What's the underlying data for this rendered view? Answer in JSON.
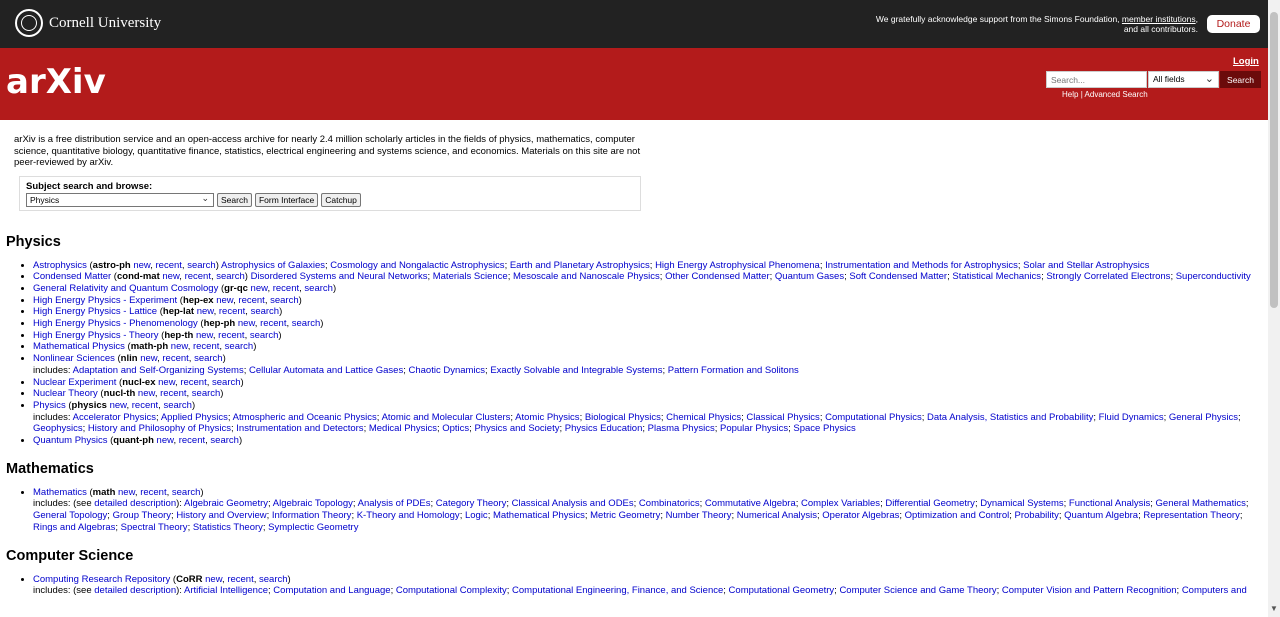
{
  "topbar": {
    "university": "Cornell University",
    "ack_prefix": "We gratefully acknowledge support from the Simons Foundation,",
    "ack_link": "member institutions",
    "ack_suffix": ", and all contributors.",
    "donate": "Donate"
  },
  "header": {
    "logo": "arXiv",
    "login": "Login",
    "search_placeholder": "Search...",
    "field_select": "All fields",
    "search_button": "Search",
    "help": "Help",
    "separator": "|",
    "advanced_search": "Advanced Search"
  },
  "intro": "arXiv is a free distribution service and an open-access archive for nearly 2.4 million scholarly articles in the fields of physics, mathematics, computer science, quantitative biology, quantitative finance, statistics, electrical engineering and systems science, and economics. Materials on this site are not peer-reviewed by arXiv.",
  "subject": {
    "label": "Subject search and browse:",
    "selected": "Physics",
    "search": "Search",
    "form_interface": "Form Interface",
    "catchup": "Catchup"
  },
  "headings": {
    "physics": "Physics",
    "mathematics": "Mathematics",
    "cs": "Computer Science"
  },
  "common": {
    "new": "new",
    "recent": "recent",
    "search": "search",
    "includes": "includes:",
    "see": "(see",
    "detailed_description": "detailed description"
  },
  "physics": {
    "astro": {
      "name": "Astrophysics",
      "code": "astro-ph",
      "subs": [
        "Astrophysics of Galaxies",
        "Cosmology and Nongalactic Astrophysics",
        "Earth and Planetary Astrophysics",
        "High Energy Astrophysical Phenomena",
        "Instrumentation and Methods for Astrophysics",
        "Solar and Stellar Astrophysics"
      ]
    },
    "cond": {
      "name": "Condensed Matter",
      "code": "cond-mat",
      "subs": [
        "Disordered Systems and Neural Networks",
        "Materials Science",
        "Mesoscale and Nanoscale Physics",
        "Other Condensed Matter",
        "Quantum Gases",
        "Soft Condensed Matter",
        "Statistical Mechanics",
        "Strongly Correlated Electrons",
        "Superconductivity"
      ]
    },
    "grqc": {
      "name": "General Relativity and Quantum Cosmology",
      "code": "gr-qc"
    },
    "hepex": {
      "name": "High Energy Physics - Experiment",
      "code": "hep-ex"
    },
    "heplat": {
      "name": "High Energy Physics - Lattice",
      "code": "hep-lat"
    },
    "hepph": {
      "name": "High Energy Physics - Phenomenology",
      "code": "hep-ph"
    },
    "hepth": {
      "name": "High Energy Physics - Theory",
      "code": "hep-th"
    },
    "mathph": {
      "name": "Mathematical Physics",
      "code": "math-ph"
    },
    "nlin": {
      "name": "Nonlinear Sciences",
      "code": "nlin",
      "subs": [
        "Adaptation and Self-Organizing Systems",
        "Cellular Automata and Lattice Gases",
        "Chaotic Dynamics",
        "Exactly Solvable and Integrable Systems",
        "Pattern Formation and Solitons"
      ]
    },
    "nuclex": {
      "name": "Nuclear Experiment",
      "code": "nucl-ex"
    },
    "nuclth": {
      "name": "Nuclear Theory",
      "code": "nucl-th"
    },
    "physics": {
      "name": "Physics",
      "code": "physics",
      "subs": [
        "Accelerator Physics",
        "Applied Physics",
        "Atmospheric and Oceanic Physics",
        "Atomic and Molecular Clusters",
        "Atomic Physics",
        "Biological Physics",
        "Chemical Physics",
        "Classical Physics",
        "Computational Physics",
        "Data Analysis, Statistics and Probability",
        "Fluid Dynamics",
        "General Physics",
        "Geophysics",
        "History and Philosophy of Physics",
        "Instrumentation and Detectors",
        "Medical Physics",
        "Optics",
        "Physics and Society",
        "Physics Education",
        "Plasma Physics",
        "Popular Physics",
        "Space Physics"
      ]
    },
    "quantph": {
      "name": "Quantum Physics",
      "code": "quant-ph"
    }
  },
  "math": {
    "name": "Mathematics",
    "code": "math",
    "subs": [
      "Algebraic Geometry",
      "Algebraic Topology",
      "Analysis of PDEs",
      "Category Theory",
      "Classical Analysis and ODEs",
      "Combinatorics",
      "Commutative Algebra",
      "Complex Variables",
      "Differential Geometry",
      "Dynamical Systems",
      "Functional Analysis",
      "General Mathematics",
      "General Topology",
      "Group Theory",
      "History and Overview",
      "Information Theory",
      "K-Theory and Homology",
      "Logic",
      "Mathematical Physics",
      "Metric Geometry",
      "Number Theory",
      "Numerical Analysis",
      "Operator Algebras",
      "Optimization and Control",
      "Probability",
      "Quantum Algebra",
      "Representation Theory",
      "Rings and Algebras",
      "Spectral Theory",
      "Statistics Theory",
      "Symplectic Geometry"
    ]
  },
  "cs": {
    "name": "Computing Research Repository",
    "code": "CoRR",
    "subs": [
      "Artificial Intelligence",
      "Computation and Language",
      "Computational Complexity",
      "Computational Engineering, Finance, and Science",
      "Computational Geometry",
      "Computer Science and Game Theory",
      "Computer Vision and Pattern Recognition",
      "Computers and"
    ]
  }
}
